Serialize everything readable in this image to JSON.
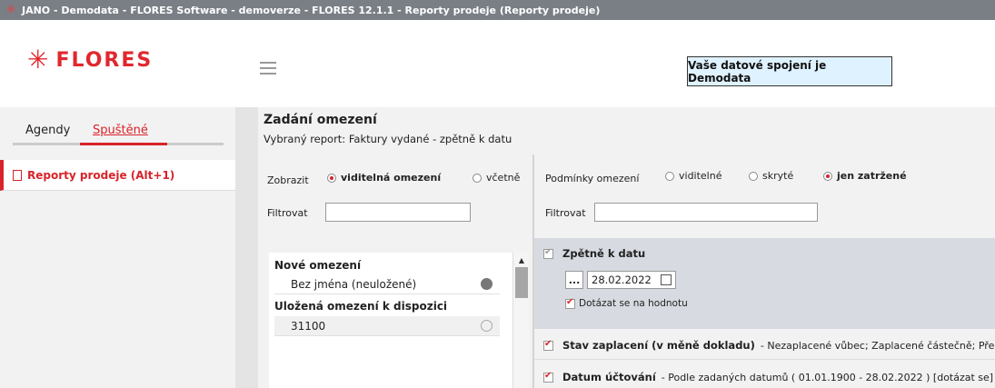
{
  "window": {
    "title": "JANO - Demodata - FLORES Software - demoverze - FLORES 12.1.1 - Reporty prodeje  (Reporty prodeje)"
  },
  "header": {
    "logo_text": "FLORES",
    "connection_label": "Vaše datové spojení je Demodata"
  },
  "sidebar": {
    "tabs": [
      {
        "label": "Agendy"
      },
      {
        "label": "Spuštěné"
      }
    ],
    "items": [
      {
        "label": "Reporty prodeje (Alt+1)"
      }
    ]
  },
  "main": {
    "title": "Zadání omezení",
    "subtitle": "Vybraný report: Faktury vydané - zpětně k datu",
    "left": {
      "show_label": "Zobrazit",
      "show_options": [
        {
          "label": "viditelná omezení",
          "selected": true
        },
        {
          "label": "včetně",
          "selected": false
        }
      ],
      "filter_label": "Filtrovat",
      "filter_value": "",
      "list": {
        "group_new": "Nové omezení",
        "new_item": "Bez jména (neuložené)",
        "group_saved": "Uložená omezení k dispozici",
        "saved_item": "31100"
      }
    },
    "right": {
      "conditions_label": "Podmínky omezení",
      "conditions_options": [
        {
          "label": "viditelné",
          "selected": false
        },
        {
          "label": "skryté",
          "selected": false
        },
        {
          "label": "jen zatržené",
          "selected": true
        }
      ],
      "filter_label": "Filtrovat",
      "filter_value": "",
      "conditions": [
        {
          "name": "Zpětně k datu",
          "date_button": "...",
          "date_value": "28.02.2022",
          "ask_label": "Dotázat se na hodnotu"
        },
        {
          "name": "Stav zaplacení (v měně dokladu)",
          "desc": "- Nezaplacené vůbec; Zaplacené částečně; Přeplace"
        },
        {
          "name": "Datum účtování",
          "desc": "- Podle zadaných datumů ( 01.01.1900 - 28.02.2022 ) [dotázat se]"
        }
      ]
    }
  }
}
